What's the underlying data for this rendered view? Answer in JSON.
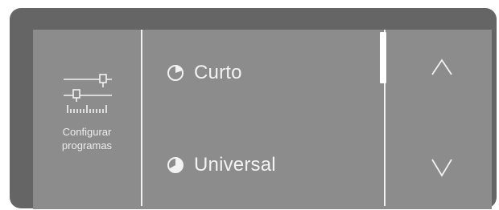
{
  "sidebar": {
    "icon": "sliders-settings-icon",
    "label_line1": "Configurar",
    "label_line2": "programas"
  },
  "programs": [
    {
      "label": "Curto",
      "icon": "pie-short-icon"
    },
    {
      "label": "Universal",
      "icon": "pie-universal-icon"
    }
  ],
  "navigation": {
    "up_icon": "chevron-up-icon",
    "down_icon": "chevron-down-icon"
  },
  "scroll": {
    "position": 0
  },
  "colors": {
    "bezel": "#656565",
    "screen": "#8c8c8c",
    "foreground": "#f2f2f2"
  }
}
